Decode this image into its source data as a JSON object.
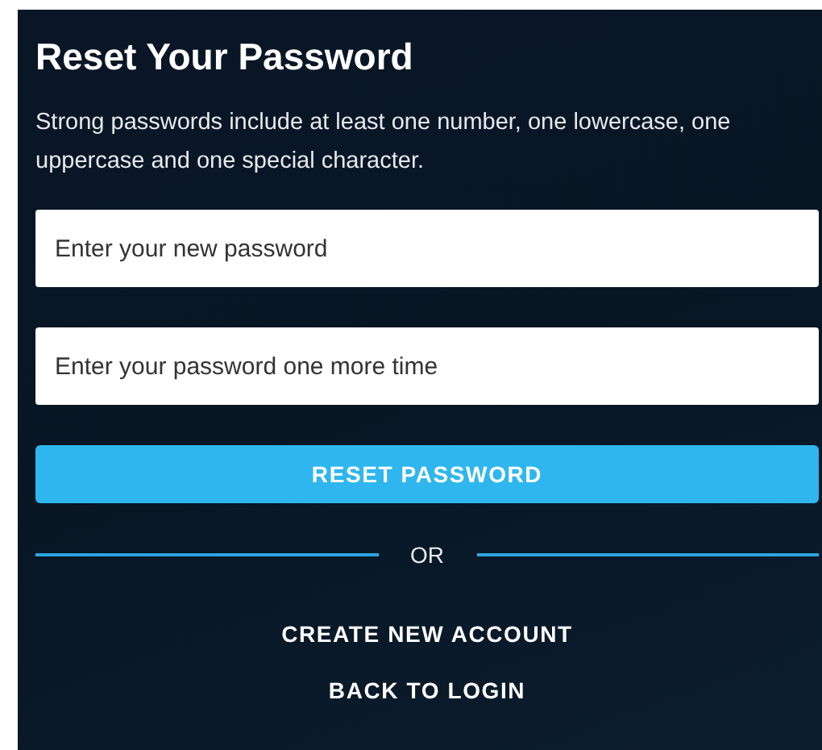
{
  "title": "Reset Your Password",
  "hint": "Strong passwords include at least one number, one lowercase, one uppercase and one special character.",
  "fields": [
    {
      "placeholder": "Enter your new password"
    },
    {
      "placeholder": "Enter your password one more time"
    }
  ],
  "submit": "RESET PASSWORD",
  "divider": "OR",
  "links": [
    "CREATE NEW ACCOUNT",
    "BACK TO LOGIN"
  ]
}
